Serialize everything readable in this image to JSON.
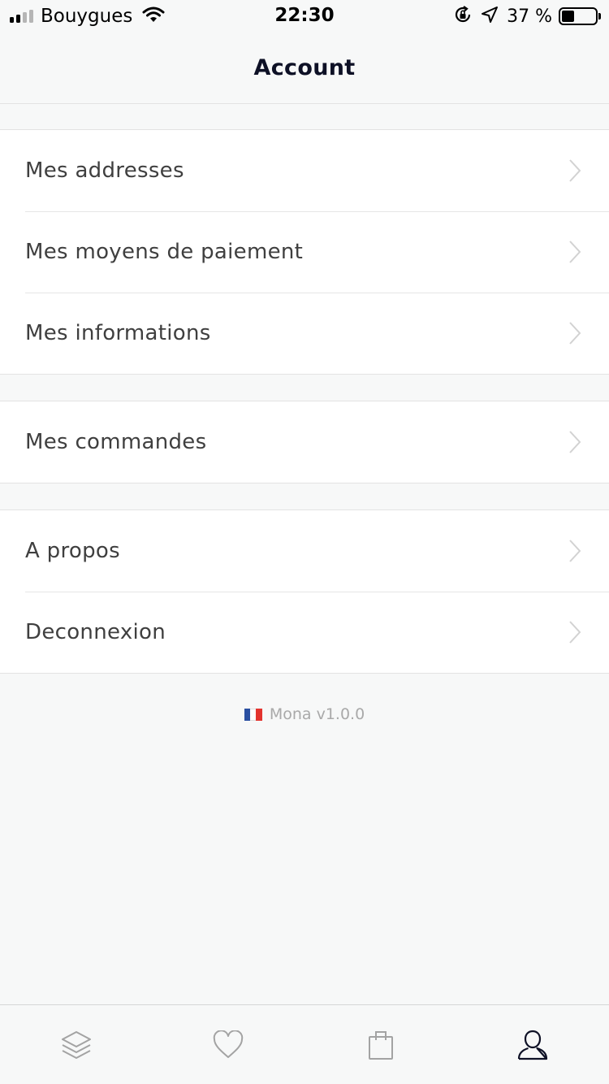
{
  "status_bar": {
    "carrier": "Bouygues",
    "time": "22:30",
    "battery_percent": "37 %",
    "battery_level": 0.37,
    "signal_bars_filled": 2,
    "signal_bars_total": 4,
    "icons": [
      "wifi-icon",
      "orientation-lock-icon",
      "location-arrow-icon",
      "battery-icon"
    ]
  },
  "nav": {
    "title": "Account"
  },
  "groups": [
    {
      "items": [
        {
          "label": "Mes addresses"
        },
        {
          "label": "Mes moyens de paiement"
        },
        {
          "label": "Mes informations"
        }
      ]
    },
    {
      "items": [
        {
          "label": "Mes commandes"
        }
      ]
    },
    {
      "items": [
        {
          "label": "A propos"
        },
        {
          "label": "Deconnexion"
        }
      ]
    }
  ],
  "footer": {
    "version": "Mona v1.0.0",
    "flag_icon": "france-flag-icon"
  },
  "tab_bar": {
    "tabs": [
      {
        "icon": "layers-icon",
        "active": false
      },
      {
        "icon": "heart-icon",
        "active": false
      },
      {
        "icon": "shopping-bag-icon",
        "active": false
      },
      {
        "icon": "user-icon",
        "active": true
      }
    ]
  },
  "colors": {
    "background": "#f7f8f8",
    "cell": "#ffffff",
    "separator": "#e3e3e3",
    "text": "#3f3f3f",
    "title": "#0e1126",
    "chevron": "#d2d2d2",
    "inactive_icon": "#a3a3a3",
    "active_icon": "#0e1126",
    "flag_blue": "#2a4fa1",
    "flag_white": "#ffffff",
    "flag_red": "#e3342f"
  }
}
